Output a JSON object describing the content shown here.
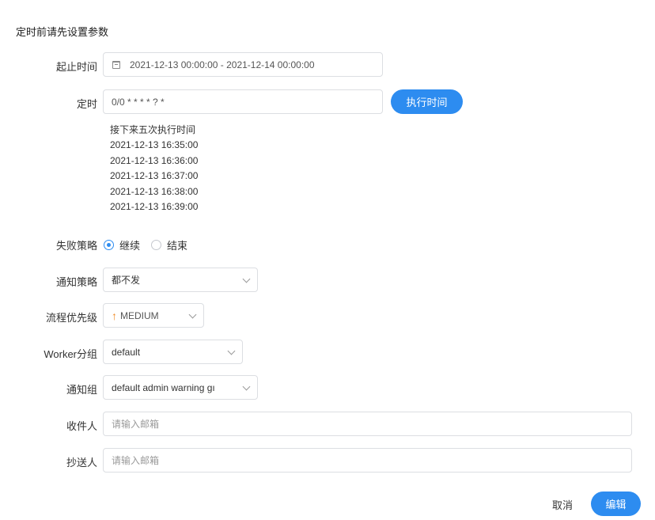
{
  "title": "定时前请先设置参数",
  "range": {
    "label": "起止时间",
    "value": "2021-12-13 00:00:00 - 2021-12-14 00:00:00"
  },
  "cron": {
    "label": "定时",
    "value": "0/0 * * * * ? *",
    "exec_button": "执行时间"
  },
  "next_runs": {
    "heading": "接下来五次执行时间",
    "times": [
      "2021-12-13 16:35:00",
      "2021-12-13 16:36:00",
      "2021-12-13 16:37:00",
      "2021-12-13 16:38:00",
      "2021-12-13 16:39:00"
    ]
  },
  "failure_strategy": {
    "label": "失败策略",
    "options": [
      "继续",
      "结束"
    ],
    "selected": "继续"
  },
  "notify_strategy": {
    "label": "通知策略",
    "value": "都不发"
  },
  "priority": {
    "label": "流程优先级",
    "value": "MEDIUM",
    "color": "#f08a24"
  },
  "worker_group": {
    "label": "Worker分组",
    "value": "default"
  },
  "notify_group": {
    "label": "通知组",
    "value": "default admin warning gı"
  },
  "receivers": {
    "label": "收件人",
    "placeholder": "请输入邮箱"
  },
  "cc": {
    "label": "抄送人",
    "placeholder": "请输入邮箱"
  },
  "footer": {
    "cancel": "取消",
    "edit": "编辑"
  },
  "colors": {
    "primary": "#2d8cf0",
    "border": "#dcdee2"
  }
}
